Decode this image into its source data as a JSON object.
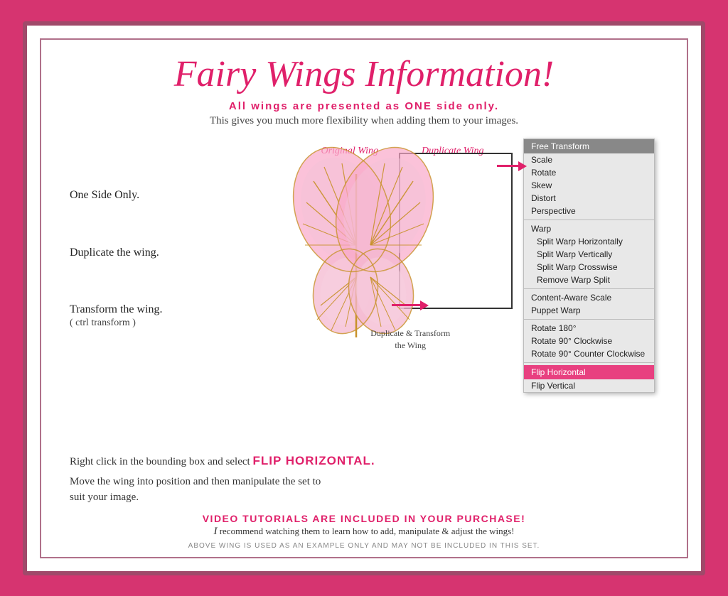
{
  "title": "Fairy Wings Information!",
  "subtitle": {
    "line1_prefix": "All wings are presented as ",
    "line1_bold": "ONE",
    "line1_suffix": " side only.",
    "line2": "This gives you much more flexibility when adding them to your images."
  },
  "left_labels": {
    "one_side": "One Side Only.",
    "duplicate": "Duplicate the wing.",
    "transform": "Transform the wing.",
    "transform_sub": "( ctrl transform )"
  },
  "wing_labels": {
    "original": "Original Wing",
    "duplicate": "Duplicate Wing"
  },
  "caption": "Duplicate & Transform\nthe Wing",
  "flip_line": "Right click in the bounding box and select",
  "flip_action": "FLIP HORIZONTAL.",
  "move_line": "Move the wing into position and then manipulate the set to\nsuit your image.",
  "video_line": "VIDEO TUTORIALS ARE INCLUDED IN YOUR PURCHASE!",
  "recommend_line": "I recommend watching them to learn how to add, manipulate & adjust the wings!",
  "disclaimer": "ABOVE WING IS USED AS AN EXAMPLE ONLY AND MAY NOT BE INCLUDED IN THIS SET.",
  "menu": {
    "items": [
      {
        "label": "Free Transform",
        "style": "selected"
      },
      {
        "label": "Scale",
        "style": "normal"
      },
      {
        "label": "Rotate",
        "style": "normal"
      },
      {
        "label": "Skew",
        "style": "normal"
      },
      {
        "label": "Distort",
        "style": "normal"
      },
      {
        "label": "Perspective",
        "style": "normal"
      },
      {
        "divider": true
      },
      {
        "label": "Warp",
        "style": "normal"
      },
      {
        "label": "Split Warp Horizontally",
        "style": "indent"
      },
      {
        "label": "Split Warp Vertically",
        "style": "indent"
      },
      {
        "label": "Split Warp Crosswise",
        "style": "indent"
      },
      {
        "label": "Remove Warp Split",
        "style": "indent"
      },
      {
        "divider": true
      },
      {
        "label": "Content-Aware Scale",
        "style": "normal"
      },
      {
        "label": "Puppet Warp",
        "style": "normal"
      },
      {
        "divider": true
      },
      {
        "label": "Rotate 180°",
        "style": "normal"
      },
      {
        "label": "Rotate 90° Clockwise",
        "style": "normal"
      },
      {
        "label": "Rotate 90° Counter Clockwise",
        "style": "normal"
      },
      {
        "divider": true
      },
      {
        "label": "Flip Horizontal",
        "style": "highlighted"
      },
      {
        "label": "Flip Vertical",
        "style": "normal"
      }
    ]
  }
}
